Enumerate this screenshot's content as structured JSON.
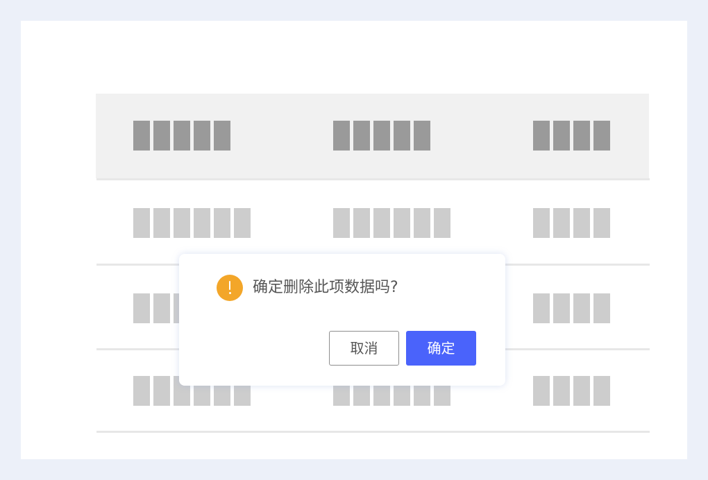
{
  "colors": {
    "page_background": "#ecf0f9",
    "card_background": "#ffffff",
    "header_background": "#f1f1f1",
    "header_placeholder": "#9a9a9a",
    "row_placeholder": "#cdcdcd",
    "divider": "#e7e7e7",
    "warning_icon": "#f3a629",
    "primary_button": "#4a63fb"
  },
  "table": {
    "header_placeholder_blocks": [
      5,
      5,
      4
    ],
    "rows_placeholder_blocks": [
      [
        6,
        6,
        4
      ],
      [
        6,
        6,
        4
      ],
      [
        6,
        6,
        4
      ]
    ]
  },
  "dialog": {
    "icon": "warning-exclamation-icon",
    "message": "确定删除此项数据吗?",
    "cancel_label": "取消",
    "confirm_label": "确定"
  }
}
